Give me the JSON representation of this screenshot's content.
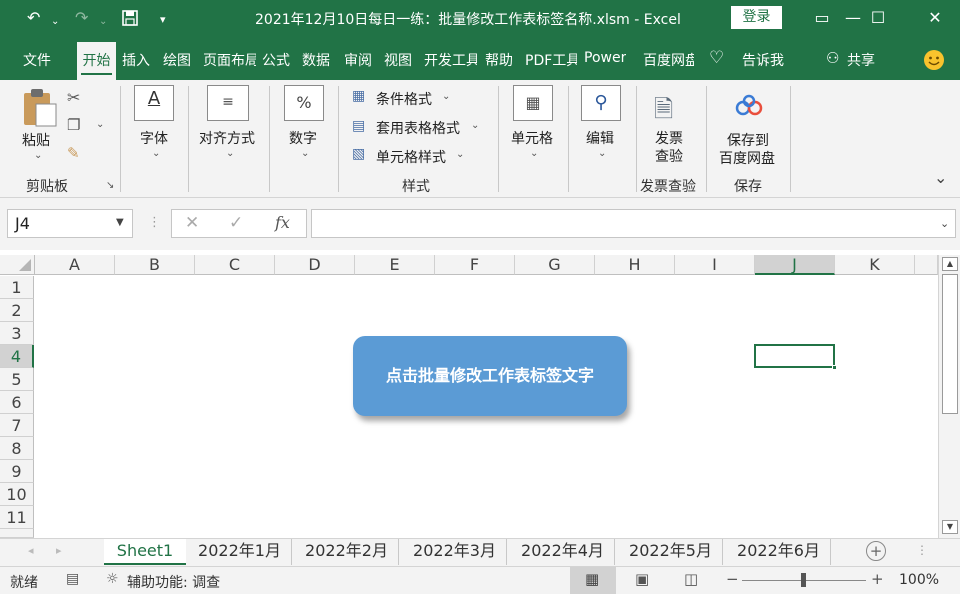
{
  "titlebar": {
    "title": "2021年12月10日每日一练：批量修改工作表标签名称.xlsm  -  Excel",
    "login": "登录",
    "undo_icon": "undo-icon",
    "redo_icon": "redo-icon",
    "save_icon": "save-icon"
  },
  "tabs": [
    "文件",
    "开始",
    "插入",
    "绘图",
    "页面布局",
    "公式",
    "数据",
    "审阅",
    "视图",
    "开发工具",
    "帮助",
    "PDF工具",
    "Power",
    "百度网盘",
    "告诉我",
    "共享"
  ],
  "ribbon": {
    "paste": "粘贴",
    "clipboard": "剪贴板",
    "font": "字体",
    "align": "对齐方式",
    "number": "数字",
    "cond_format": "条件格式",
    "table_format": "套用表格格式",
    "cell_style": "单元格样式",
    "styles": "样式",
    "cells": "单元格",
    "edit": "编辑",
    "invoice_check": "发票\n查验",
    "invoice_group": "发票查验",
    "save_baidu_1": "保存到",
    "save_baidu_2": "百度网盘",
    "save_group": "保存"
  },
  "formula": {
    "namebox": "J4",
    "fx": "fx"
  },
  "grid": {
    "columns": [
      "A",
      "B",
      "C",
      "D",
      "E",
      "F",
      "G",
      "H",
      "I",
      "J",
      "K"
    ],
    "rows": [
      "1",
      "2",
      "3",
      "4",
      "5",
      "6",
      "7",
      "8",
      "9",
      "10",
      "11"
    ],
    "selected_col": "J",
    "selected_row": "4",
    "callout_text": "点击批量修改工作表标签文字"
  },
  "sheets": [
    "Sheet1",
    "2022年1月",
    "2022年2月",
    "2022年3月",
    "2022年4月",
    "2022年5月",
    "2022年6月"
  ],
  "status": {
    "ready": "就绪",
    "accessibility": "辅助功能: 调查",
    "zoom": "100%"
  },
  "colors": {
    "excel_green": "#217346",
    "callout_blue": "#5b9bd5"
  }
}
